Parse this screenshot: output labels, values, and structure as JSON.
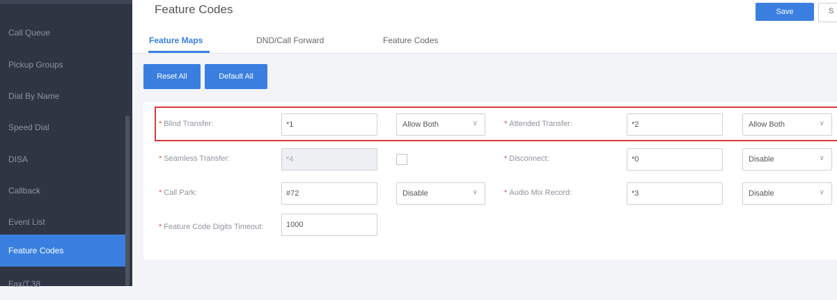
{
  "sidebar": {
    "items": [
      {
        "label": "Call Queue",
        "active": false
      },
      {
        "label": "Pickup Groups",
        "active": false
      },
      {
        "label": "Dial By Name",
        "active": false
      },
      {
        "label": "Speed Dial",
        "active": false
      },
      {
        "label": "DISA",
        "active": false
      },
      {
        "label": "Callback",
        "active": false
      },
      {
        "label": "Event List",
        "active": false
      },
      {
        "label": "Feature Codes",
        "active": true
      },
      {
        "label": "Fax/T.38",
        "active": false
      }
    ]
  },
  "header": {
    "title": "Feature Codes",
    "save_label": "Save",
    "second_button_label": "S"
  },
  "tabs": [
    {
      "label": "Feature Maps",
      "active": true
    },
    {
      "label": "DND/Call Forward",
      "active": false
    },
    {
      "label": "Feature Codes",
      "active": false
    }
  ],
  "actions": {
    "reset_all": "Reset All",
    "default_all": "Default All"
  },
  "form": {
    "blind_transfer": {
      "label": "Blind Transfer:",
      "value": "*1",
      "option": "Allow Both"
    },
    "attended_transfer": {
      "label": "Attended Transfer:",
      "value": "*2",
      "option": "Allow Both"
    },
    "seamless_transfer": {
      "label": "Seamless Transfer:",
      "value": "*4",
      "checked": false
    },
    "disconnect": {
      "label": "Disconnect:",
      "value": "*0",
      "option": "Disable"
    },
    "call_park": {
      "label": "Call Park:",
      "value": "#72",
      "option": "Disable"
    },
    "audio_mix_record": {
      "label": "Audio Mix Record:",
      "value": "*3",
      "option": "Disable"
    },
    "digits_timeout": {
      "label": "Feature Code Digits Timeout:",
      "value": "1000"
    }
  },
  "colors": {
    "accent": "#3a7fe0",
    "sidebar_bg": "#2f3542",
    "highlight_border": "#d93a3a",
    "required_star": "#e64a4a"
  },
  "icons": {
    "select_chevron": "chevron-down-icon"
  }
}
